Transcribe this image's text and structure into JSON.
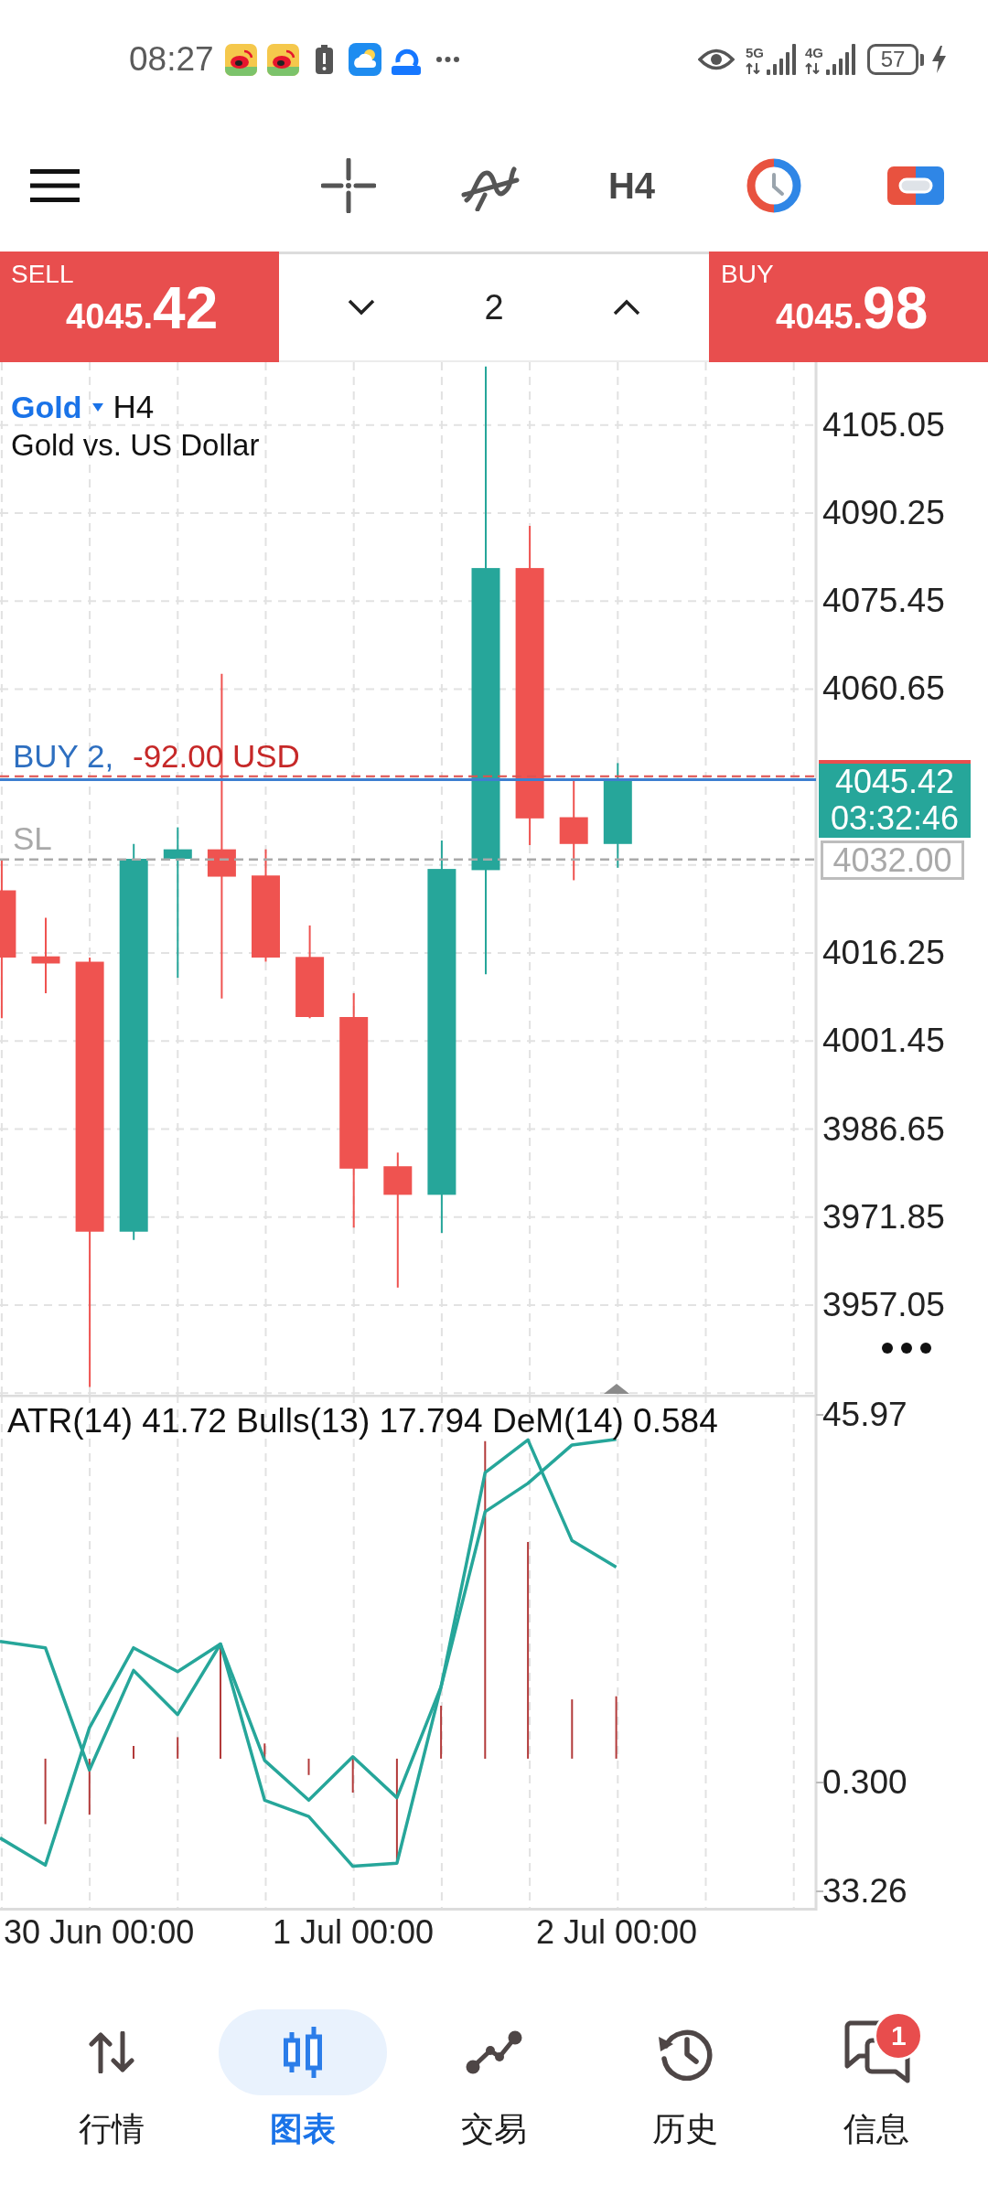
{
  "status_bar": {
    "time": "08:27",
    "networks": [
      {
        "label": "5G"
      },
      {
        "label": "4G"
      }
    ],
    "battery": "57",
    "charging": true
  },
  "toolbar": {
    "timeframe": "H4"
  },
  "trade_bar": {
    "sell": {
      "label": "SELL",
      "price": "4045.",
      "pips": "42"
    },
    "lot": "2",
    "buy": {
      "label": "BUY",
      "price": "4045.",
      "pips": "98"
    }
  },
  "chart": {
    "symbol": "Gold",
    "timeframe": "H4",
    "description": "Gold vs. US Dollar",
    "price_axis": [
      "4105.05",
      "4090.25",
      "4075.45",
      "4060.65",
      "4016.25",
      "4001.45",
      "3986.65",
      "3971.85",
      "3957.05"
    ],
    "position": {
      "label": "BUY 2,",
      "profit": "-92.00 USD"
    },
    "bid_tag": {
      "price": "4045.42",
      "countdown": "03:32:46"
    },
    "stop_loss": {
      "label": "SL",
      "price": "4032.00"
    }
  },
  "indicator": {
    "legend": "ATR(14) 41.72 Bulls(13) 17.794 DeM(14) 0.584",
    "axis_labels": [
      "45.97",
      "0.300",
      "33.26"
    ]
  },
  "time_axis": [
    "30 Jun 00:00",
    "1 Jul 00:00",
    "2 Jul 00:00"
  ],
  "nav": [
    {
      "label": "行情",
      "selected": false
    },
    {
      "label": "图表",
      "selected": true
    },
    {
      "label": "交易",
      "selected": false
    },
    {
      "label": "历史",
      "selected": false
    },
    {
      "label": "信息",
      "selected": false,
      "badge": "1"
    }
  ]
}
